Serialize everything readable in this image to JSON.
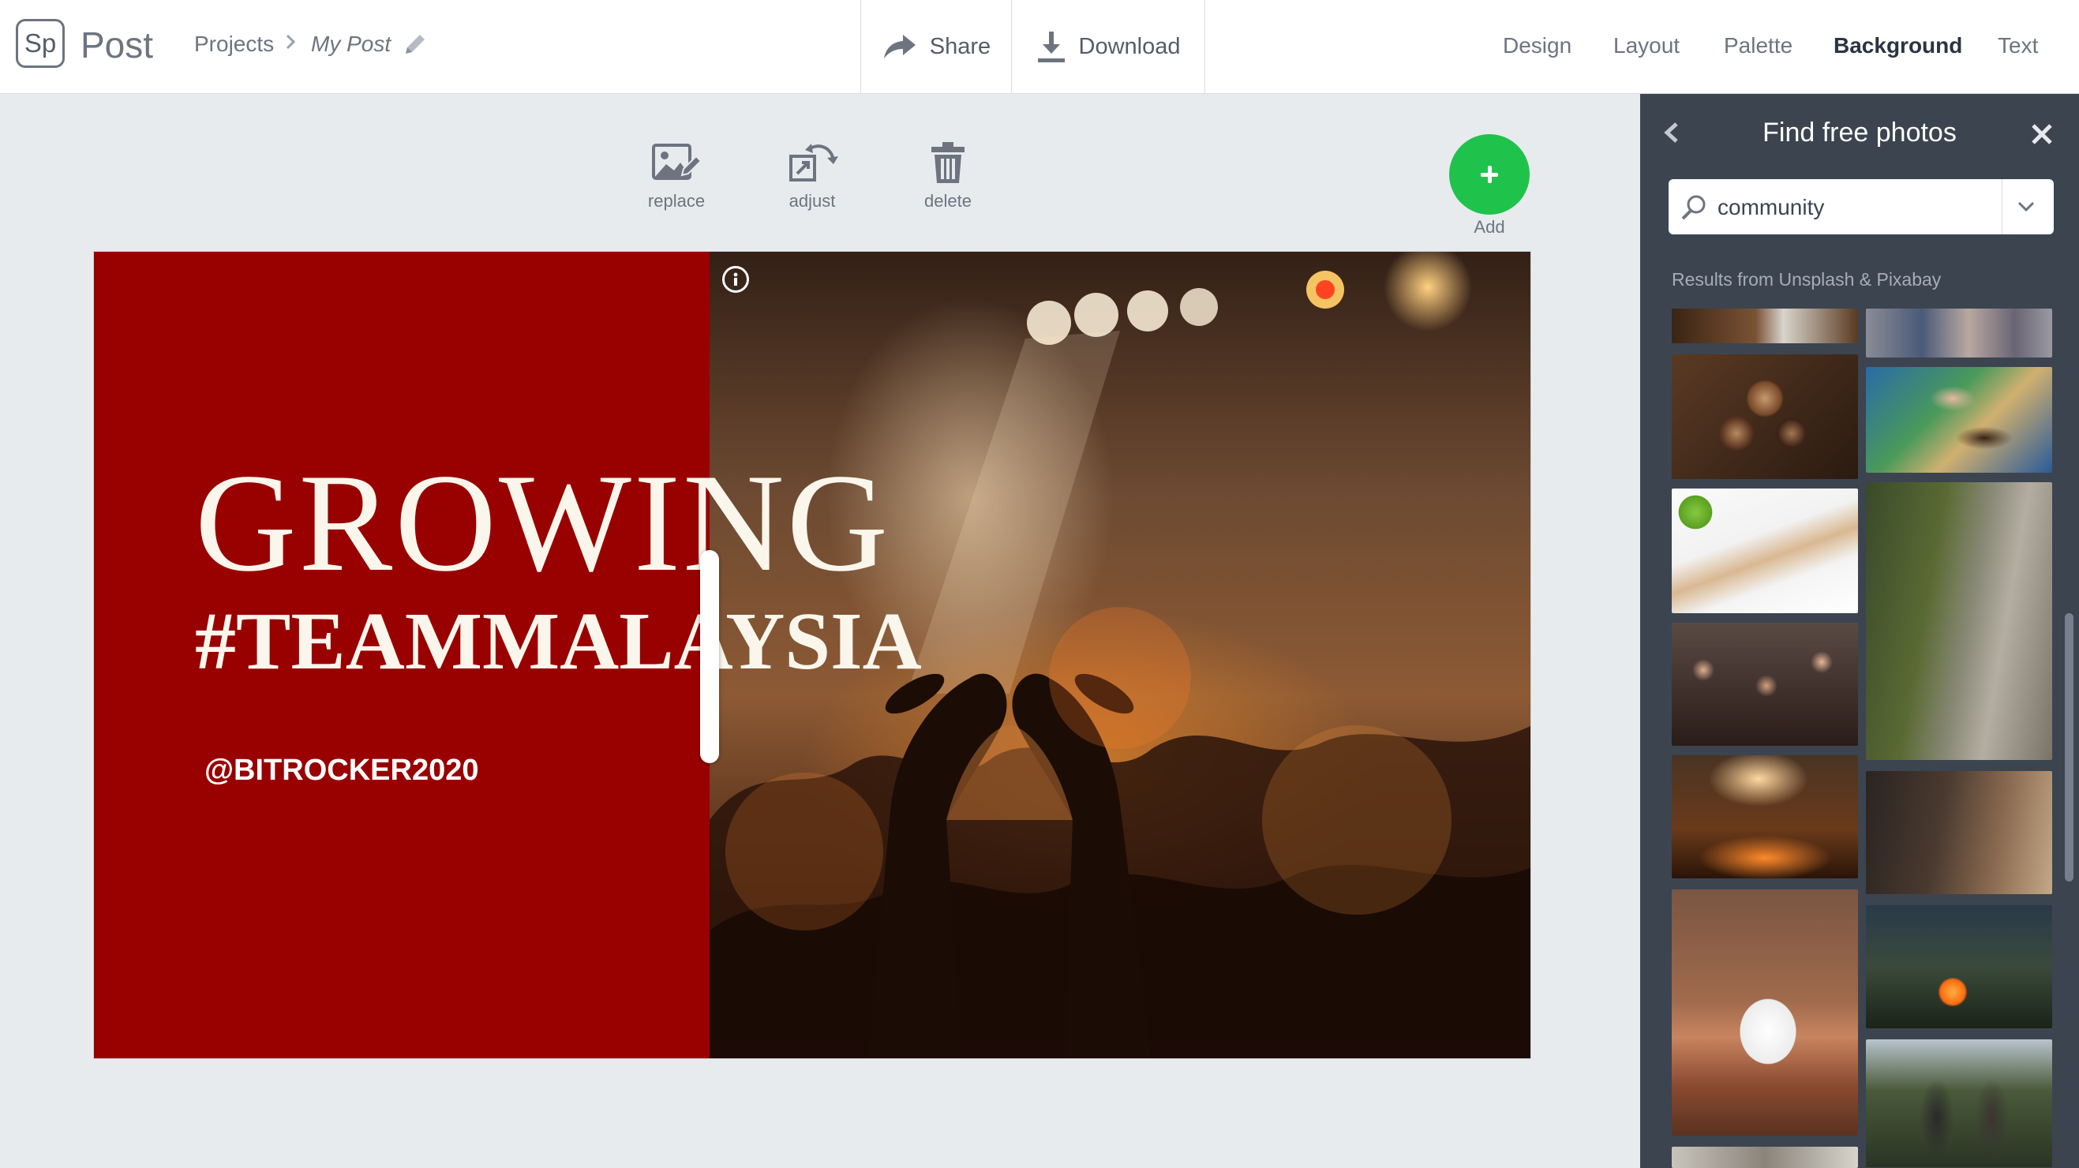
{
  "app": {
    "logo": "Sp",
    "name": "Post"
  },
  "breadcrumb": {
    "root": "Projects",
    "current": "My Post"
  },
  "actions": {
    "share": "Share",
    "download": "Download"
  },
  "tabs": [
    {
      "label": "Design",
      "active": false
    },
    {
      "label": "Layout",
      "active": false
    },
    {
      "label": "Palette",
      "active": false
    },
    {
      "label": "Background",
      "active": true
    },
    {
      "label": "Text",
      "active": false
    }
  ],
  "toolbar": {
    "replace": "replace",
    "adjust": "adjust",
    "delete": "delete",
    "add": "Add"
  },
  "canvas": {
    "headline": "GROWING",
    "subheadline": "#TEAMMALAYSIA",
    "handle": "@BITROCKER2020",
    "panel_color": "#990000"
  },
  "photos_panel": {
    "title": "Find free photos",
    "search_value": "community",
    "results_label": "Results from Unsplash & Pixabay",
    "thumbnails": [
      "wood-table-photo",
      "crowd-street-photo",
      "coffee-cups-photo",
      "hands-map-photo",
      "phone-apple-photo",
      "cliff-climbers-photo",
      "concert-crowd-photo",
      "meeting-table-photo",
      "concert-hearts-photo",
      "campfire-photo",
      "coffee-mug-photo",
      "friends-forest-photo"
    ]
  },
  "colors": {
    "accent": "#1fc34c",
    "panel": "#3c4450",
    "red": "#990000"
  },
  "icons": [
    "pencil-icon",
    "share-icon",
    "download-icon",
    "replace-icon",
    "adjust-icon",
    "trash-icon",
    "plus-icon",
    "info-icon",
    "back-chevron-icon",
    "close-icon",
    "search-icon",
    "dropdown-chevron-icon"
  ]
}
